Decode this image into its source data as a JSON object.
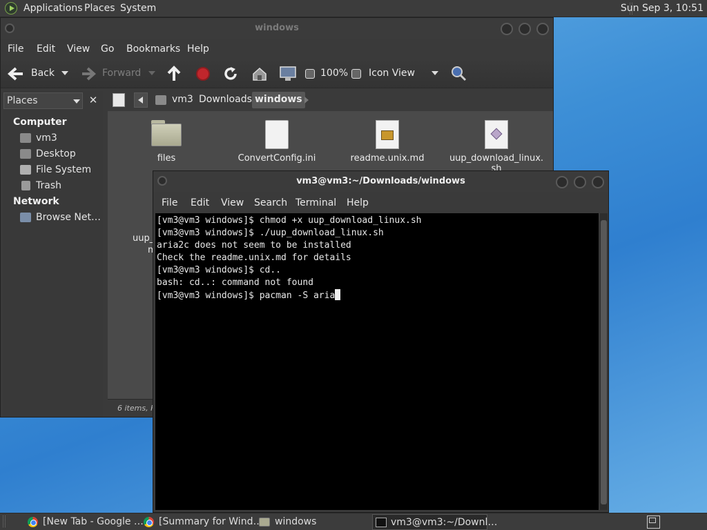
{
  "top_panel": {
    "menus": [
      "Applications",
      "Places",
      "System"
    ],
    "clock": "Sun Sep  3, 10:51"
  },
  "file_manager": {
    "title": "windows",
    "menus": [
      "File",
      "Edit",
      "View",
      "Go",
      "Bookmarks",
      "Help"
    ],
    "toolbar": {
      "back": "Back",
      "forward": "Forward",
      "zoom": "100%",
      "view_mode": "Icon View"
    },
    "sidebar": {
      "selector": "Places",
      "computer_heading": "Computer",
      "computer_items": [
        "vm3",
        "Desktop",
        "File System",
        "Trash"
      ],
      "network_heading": "Network",
      "network_items": [
        "Browse Net…"
      ]
    },
    "path": [
      "vm3",
      "Downloads",
      "windows"
    ],
    "files": [
      {
        "name": "files",
        "icon": "folder-icon"
      },
      {
        "name": "ConvertConfig.ini",
        "icon": "document-icon"
      },
      {
        "name": "readme.unix.md",
        "icon": "text-image-icon"
      },
      {
        "name": "uup_download_linux.",
        "name2": "sh",
        "icon": "script-icon"
      }
    ],
    "partial_file": {
      "line1": "uup_c",
      "line2": "m"
    },
    "status": "6 items, Fre"
  },
  "terminal": {
    "title": "vm3@vm3:~/Downloads/windows",
    "menus": [
      "File",
      "Edit",
      "View",
      "Search",
      "Terminal",
      "Help"
    ],
    "lines": [
      "[vm3@vm3 windows]$ chmod +x uup_download_linux.sh",
      "[vm3@vm3 windows]$ ./uup_download_linux.sh",
      "aria2c does not seem to be installed",
      "Check the readme.unix.md for details",
      "[vm3@vm3 windows]$ cd..",
      "bash: cd..: command not found",
      "[vm3@vm3 windows]$ pacman -S aria"
    ]
  },
  "taskbar": {
    "tasks": [
      {
        "label": "[New Tab - Google …",
        "icon": "chrome-icon"
      },
      {
        "label": "[Summary for Wind…",
        "icon": "chrome-icon"
      },
      {
        "label": "windows",
        "icon": "folder-icon"
      },
      {
        "label": "vm3@vm3:~/Downl…",
        "icon": "terminal-icon"
      }
    ]
  }
}
